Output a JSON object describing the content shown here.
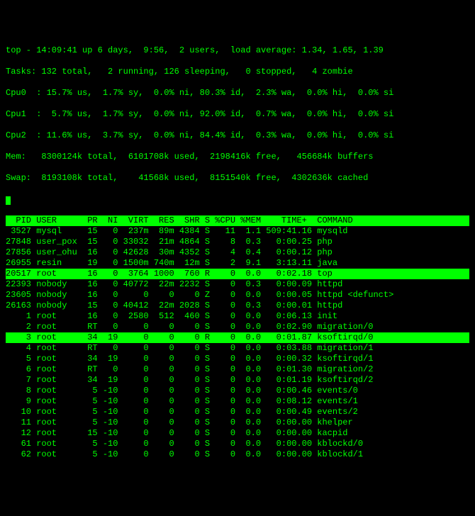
{
  "summary": {
    "line1": "top - 14:09:41 up 6 days,  9:56,  2 users,  load average: 1.34, 1.65, 1.39",
    "tasks": "Tasks: 132 total,   2 running, 126 sleeping,   0 stopped,   4 zombie",
    "cpu0": "Cpu0  : 15.7% us,  1.7% sy,  0.0% ni, 80.3% id,  2.3% wa,  0.0% hi,  0.0% si",
    "cpu1": "Cpu1  :  5.7% us,  1.7% sy,  0.0% ni, 92.0% id,  0.7% wa,  0.0% hi,  0.0% si",
    "cpu2": "Cpu2  : 11.6% us,  3.7% sy,  0.0% ni, 84.4% id,  0.3% wa,  0.0% hi,  0.0% si",
    "mem": "Mem:   8300124k total,  6101708k used,  2198416k free,   456684k buffers",
    "swap": "Swap:  8193108k total,    41568k used,  8151540k free,  4302636k cached"
  },
  "columns": "  PID USER      PR  NI  VIRT  RES  SHR S %CPU %MEM    TIME+  COMMAND           ",
  "rows": [
    {
      "hl": false,
      "text": " 3527 mysql     15   0  237m  89m 4384 S   11  1.1 509:41.16 mysqld"
    },
    {
      "hl": false,
      "text": "27848 user_pox  15   0 33032  21m 4864 S    8  0.3   0:00.25 php"
    },
    {
      "hl": false,
      "text": "27856 user_ohu  16   0 42628  30m 4352 S    4  0.4   0:00.12 php"
    },
    {
      "hl": false,
      "text": "26955 resin     19   0 1500m 740m  12m S    2  9.1   3:13.11 java"
    },
    {
      "hl": true,
      "text": "20517 root      16   0  3764 1000  760 R    0  0.0   0:02.18 top                "
    },
    {
      "hl": false,
      "text": "22393 nobody    16   0 40772  22m 2232 S    0  0.3   0:00.09 httpd"
    },
    {
      "hl": false,
      "text": "23605 nobody    16   0     0    0    0 Z    0  0.0   0:00.05 httpd <defunct>"
    },
    {
      "hl": false,
      "text": "26163 nobody    15   0 40412  22m 2028 S    0  0.3   0:00.01 httpd"
    },
    {
      "hl": false,
      "text": "    1 root      16   0  2580  512  460 S    0  0.0   0:06.13 init"
    },
    {
      "hl": false,
      "text": "    2 root      RT   0     0    0    0 S    0  0.0   0:02.90 migration/0"
    },
    {
      "hl": true,
      "text": "    3 root      34  19     0    0    0 R    0  0.0   0:01.87 ksoftirqd/0        "
    },
    {
      "hl": false,
      "text": "    4 root      RT   0     0    0    0 S    0  0.0   0:03.88 migration/1"
    },
    {
      "hl": false,
      "text": "    5 root      34  19     0    0    0 S    0  0.0   0:00.32 ksoftirqd/1"
    },
    {
      "hl": false,
      "text": "    6 root      RT   0     0    0    0 S    0  0.0   0:01.30 migration/2"
    },
    {
      "hl": false,
      "text": "    7 root      34  19     0    0    0 S    0  0.0   0:01.19 ksoftirqd/2"
    },
    {
      "hl": false,
      "text": "    8 root       5 -10     0    0    0 S    0  0.0   0:00.46 events/0"
    },
    {
      "hl": false,
      "text": "    9 root       5 -10     0    0    0 S    0  0.0   0:08.12 events/1"
    },
    {
      "hl": false,
      "text": "   10 root       5 -10     0    0    0 S    0  0.0   0:00.49 events/2"
    },
    {
      "hl": false,
      "text": "   11 root       5 -10     0    0    0 S    0  0.0   0:00.00 khelper"
    },
    {
      "hl": false,
      "text": "   12 root      15 -10     0    0    0 S    0  0.0   0:00.00 kacpid"
    },
    {
      "hl": false,
      "text": "   61 root       5 -10     0    0    0 S    0  0.0   0:00.00 kblockd/0"
    },
    {
      "hl": false,
      "text": "   62 root       5 -10     0    0    0 S    0  0.0   0:00.00 kblockd/1"
    }
  ]
}
